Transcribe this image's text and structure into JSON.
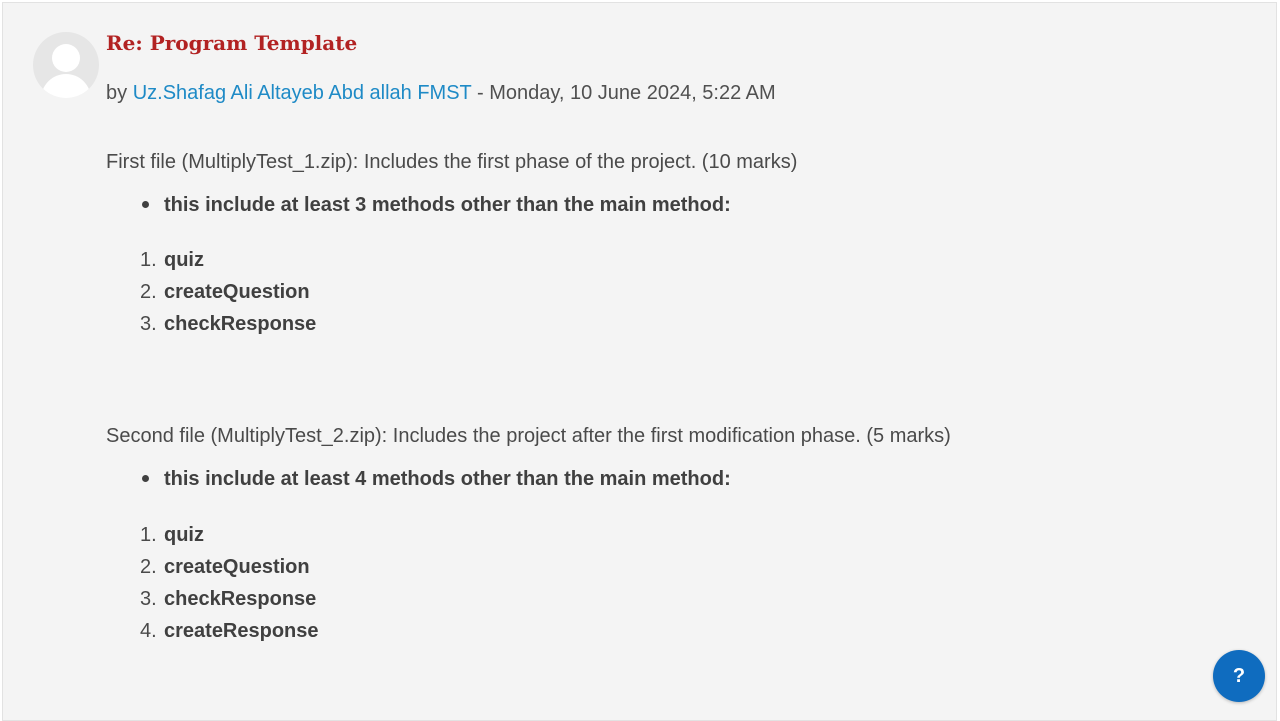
{
  "post": {
    "title": "Re: Program Template",
    "by_prefix": "by ",
    "author": "Uz.Shafag Ali Altayeb Abd allah FMST",
    "date_separator": " - ",
    "date": "Monday, 10 June 2024, 5:22 AM",
    "sections": [
      {
        "intro": "First file (MultiplyTest_1.zip): Includes the first phase of the project. (10 marks)",
        "bullet": "this include at least 3 methods other than the main method:",
        "items": [
          {
            "num": "1.",
            "text": "quiz"
          },
          {
            "num": "2.",
            "text": "createQuestion"
          },
          {
            "num": "3.",
            "text": "checkResponse"
          }
        ]
      },
      {
        "intro": "Second file (MultiplyTest_2.zip): Includes the project after the first modification phase. (5 marks)",
        "bullet": "this include at least 4 methods other than the main method:",
        "items": [
          {
            "num": "1.",
            "text": "quiz"
          },
          {
            "num": "2.",
            "text": "createQuestion"
          },
          {
            "num": "3.",
            "text": "checkResponse"
          },
          {
            "num": "4.",
            "text": "createResponse"
          }
        ]
      }
    ]
  },
  "help_button": {
    "label": "?",
    "icon": "question-mark-icon",
    "color": "#0f6cbf"
  },
  "colors": {
    "title": "#b22222",
    "author_link": "#1e8ac6",
    "background": "#f4f4f4"
  }
}
